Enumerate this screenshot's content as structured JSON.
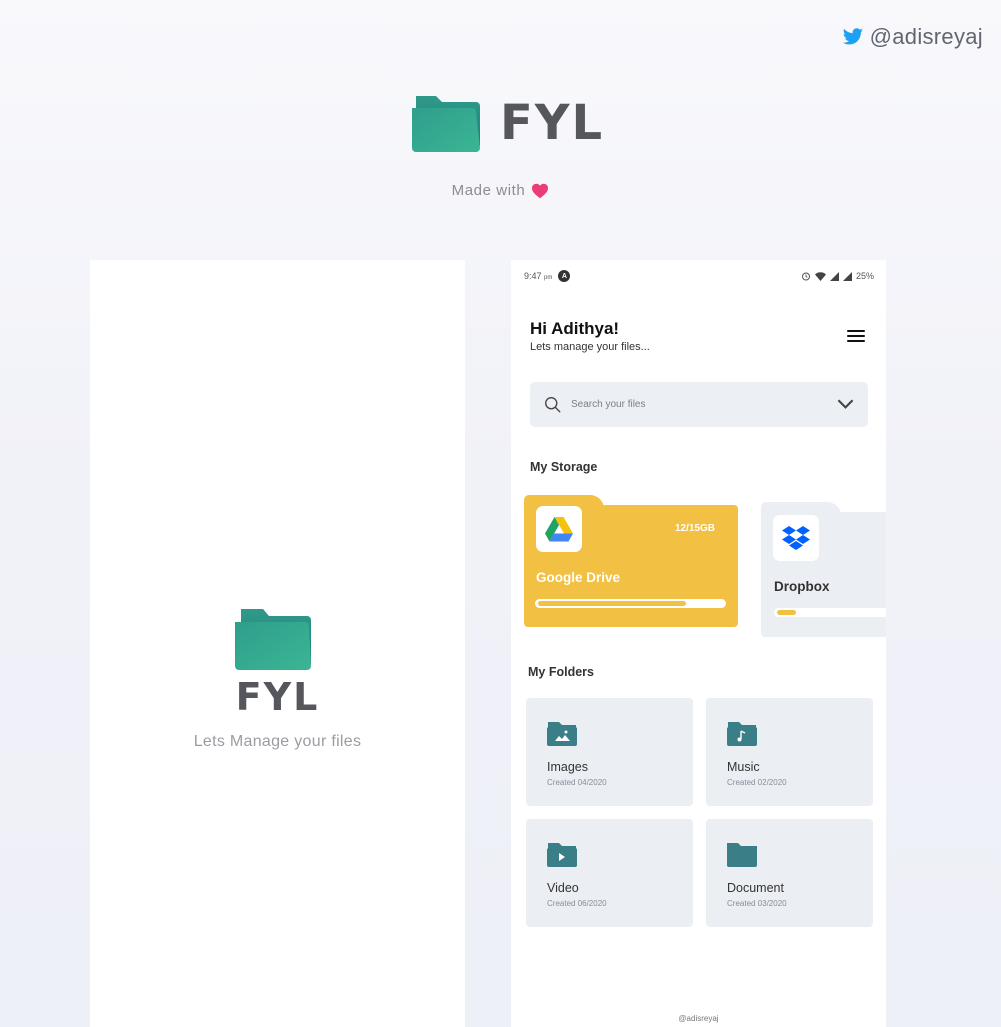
{
  "header": {
    "twitter_handle": "@adisreyaj",
    "brand_name": "FYL",
    "made_with": "Made with"
  },
  "splash": {
    "brand_name": "FYL",
    "tagline": "Lets Manage your files"
  },
  "status_bar": {
    "time": "9:47",
    "ampm": "pm",
    "notification": "A",
    "battery": "25%"
  },
  "home": {
    "greeting": "Hi Adithya!",
    "subtitle": "Lets manage your files...",
    "search": {
      "placeholder": "Search your files"
    },
    "storage_title": "My Storage",
    "storage": [
      {
        "name": "Google Drive",
        "capacity": "12/15GB",
        "used_fraction": 0.8,
        "color": "#f2c042"
      },
      {
        "name": "Dropbox",
        "used_fraction": 0.16,
        "color": "#ebeef3",
        "accent": "#f2c042"
      }
    ],
    "folders_title": "My Folders",
    "folders": [
      {
        "name": "Images",
        "date": "Created 04/2020",
        "icon": "image-folder-icon"
      },
      {
        "name": "Music",
        "date": "Created 02/2020",
        "icon": "music-folder-icon"
      },
      {
        "name": "Video",
        "date": "Created 06/2020",
        "icon": "video-folder-icon"
      },
      {
        "name": "Document",
        "date": "Created 03/2020",
        "icon": "document-folder-icon"
      }
    ],
    "footer_handle": "@adisreyaj"
  },
  "colors": {
    "brand_teal": "#2a9d8a",
    "folder_icon": "#3a7f87",
    "drive_yellow": "#f2c042",
    "heart": "#ea3d78",
    "twitter_blue": "#1da1f2"
  }
}
